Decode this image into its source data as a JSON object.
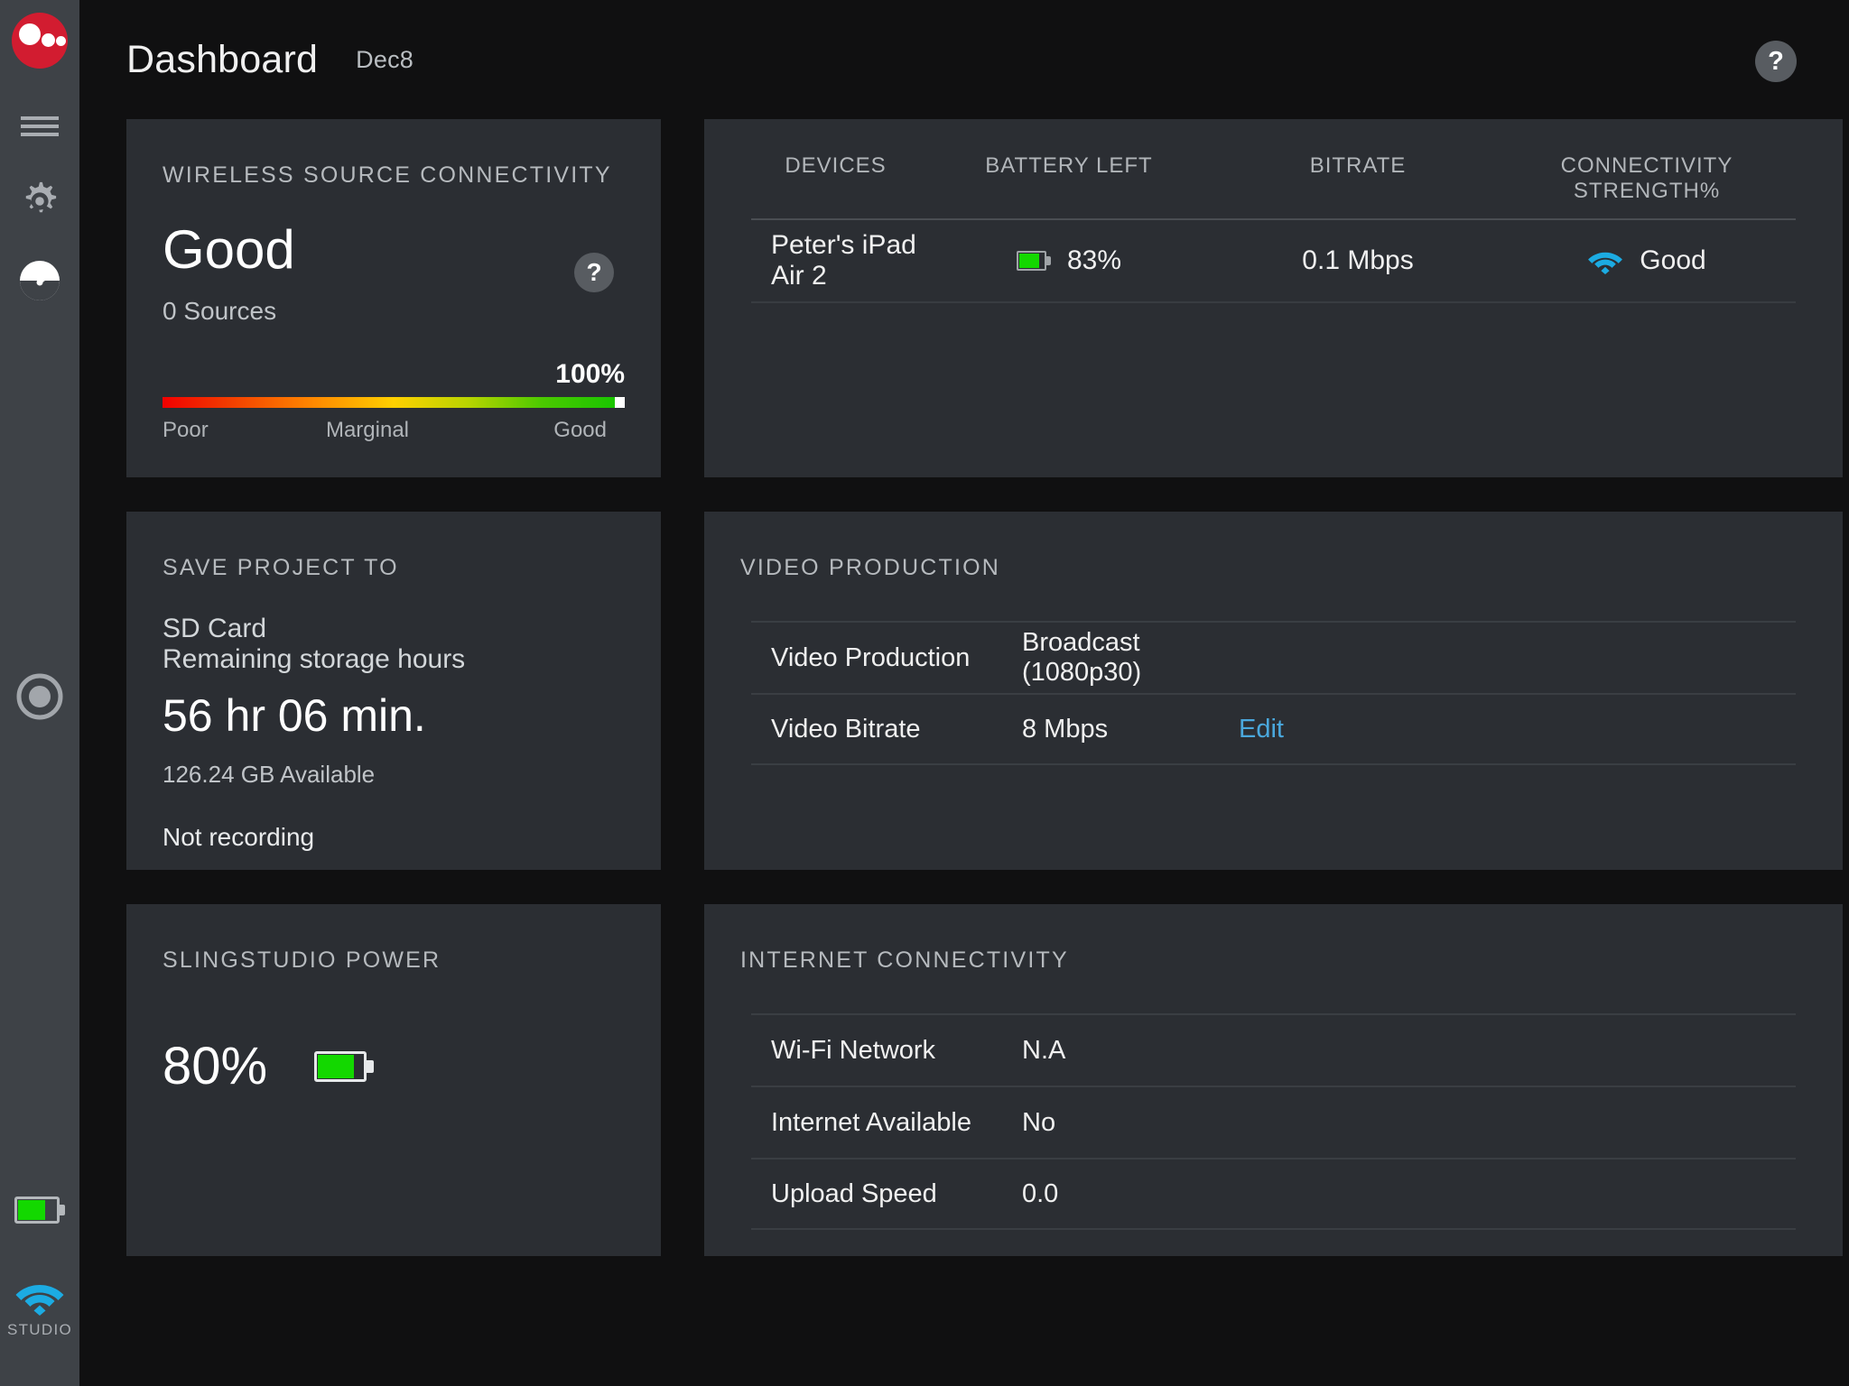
{
  "colors": {
    "brand_red": "#d21c30",
    "page_bg": "#101011",
    "sidebar_bg": "#3e4247",
    "card_bg": "#2b2e33",
    "accent_cyan": "#1cabe2",
    "link_blue": "#4aa8dd",
    "battery_green": "#13d800"
  },
  "sidebar": {
    "items": [
      {
        "name": "logo",
        "icon": "slingstudio-logo-icon"
      },
      {
        "name": "menu",
        "icon": "hamburger-menu-icon"
      },
      {
        "name": "settings",
        "icon": "gear-icon"
      },
      {
        "name": "dashboard",
        "icon": "gauge-icon"
      },
      {
        "name": "record",
        "icon": "record-button-icon"
      }
    ],
    "status": {
      "battery_percent": 80,
      "wifi_label": "STUDIO"
    }
  },
  "header": {
    "title": "Dashboard",
    "date": "Dec8",
    "help_label": "?"
  },
  "wireless_card": {
    "title": "WIRELESS SOURCE CONNECTIVITY",
    "status": "Good",
    "sources": "0 Sources",
    "help_label": "?",
    "meter": {
      "percent_label": "100%",
      "percent_value": 100,
      "labels": [
        "Poor",
        "Marginal",
        "Good"
      ]
    }
  },
  "devices_card": {
    "columns": [
      "DEVICES",
      "BATTERY LEFT",
      "BITRATE",
      "CONNECTIVITY STRENGTH%"
    ],
    "columns_display": {
      "devices": "DEVICES",
      "battery": "BATTERY LEFT",
      "bitrate": "BITRATE",
      "connectivity_line1": "CONNECTIVITY",
      "connectivity_line2": "STRENGTH%"
    },
    "rows": [
      {
        "device": "Peter's iPad Air 2",
        "battery": "83%",
        "battery_value": 83,
        "bitrate": "0.1 Mbps",
        "connectivity": "Good",
        "connectivity_icon": "wifi-icon"
      }
    ]
  },
  "save_project_card": {
    "title": "SAVE PROJECT TO",
    "destination": "SD Card",
    "remaining_label": "Remaining storage hours",
    "remaining_time": "56 hr 06 min.",
    "available": "126.24 GB Available",
    "recording_status": "Not recording"
  },
  "video_production_card": {
    "title": "VIDEO PRODUCTION",
    "rows": [
      {
        "key": "Video Production",
        "value": "Broadcast (1080p30)",
        "action": ""
      },
      {
        "key": "Video Bitrate",
        "value": "8 Mbps",
        "action": "Edit"
      }
    ]
  },
  "power_card": {
    "title": "SLINGSTUDIO POWER",
    "percent": "80%",
    "percent_value": 80
  },
  "internet_card": {
    "title": "INTERNET CONNECTIVITY",
    "rows": [
      {
        "key": "Wi-Fi Network",
        "value": "N.A"
      },
      {
        "key": "Internet Available",
        "value": "No"
      },
      {
        "key": "Upload Speed",
        "value": "0.0"
      }
    ]
  }
}
